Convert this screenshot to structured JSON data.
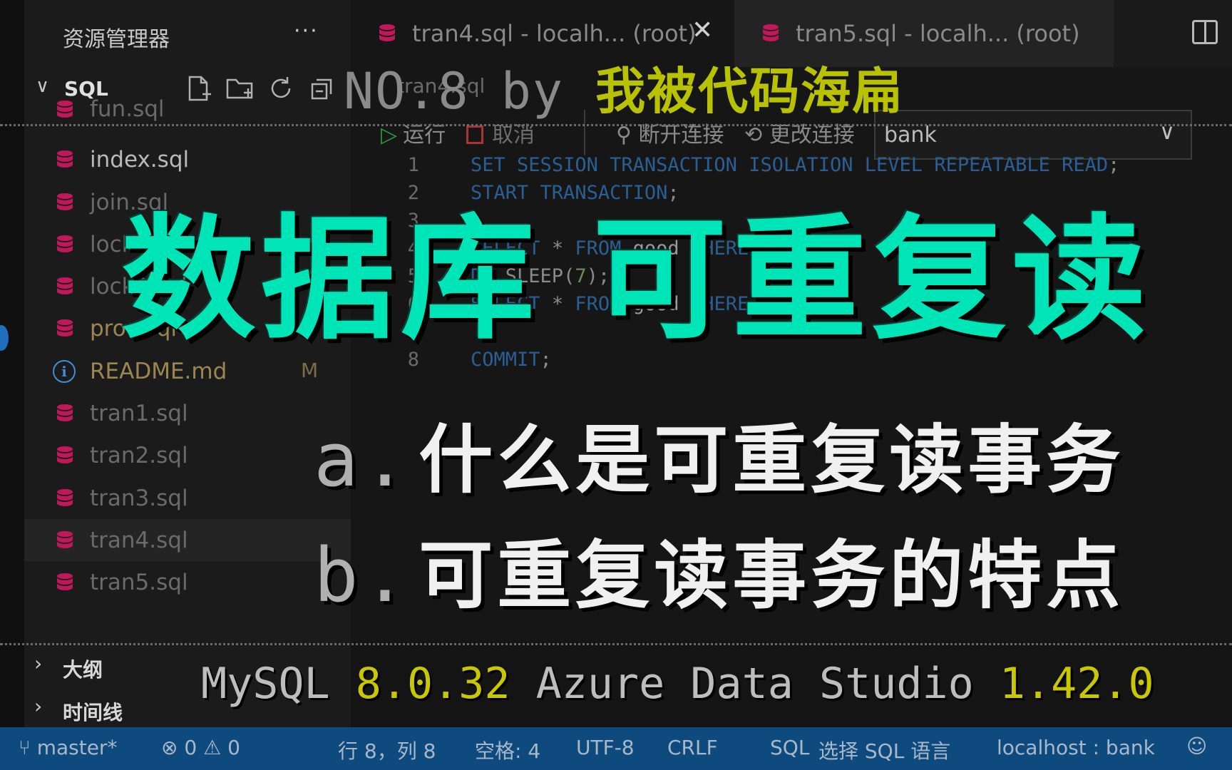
{
  "sidebar": {
    "title": "资源管理器",
    "more": "···",
    "section_title": "SQL",
    "files": [
      {
        "name": "fun.sql",
        "icon": "database-icon",
        "badge": ""
      },
      {
        "name": "index.sql",
        "icon": "database-icon",
        "badge": ""
      },
      {
        "name": "join.sql",
        "icon": "database-icon",
        "badge": ""
      },
      {
        "name": "lock.sql",
        "icon": "database-icon",
        "badge": ""
      },
      {
        "name": "lock2.sql",
        "icon": "database-icon",
        "badge": ""
      },
      {
        "name": "proc.sql",
        "icon": "database-icon",
        "badge": "M"
      },
      {
        "name": "README.md",
        "icon": "info-icon",
        "badge": "M"
      },
      {
        "name": "tran1.sql",
        "icon": "database-icon",
        "badge": ""
      },
      {
        "name": "tran2.sql",
        "icon": "database-icon",
        "badge": ""
      },
      {
        "name": "tran3.sql",
        "icon": "database-icon",
        "badge": ""
      },
      {
        "name": "tran4.sql",
        "icon": "database-icon",
        "badge": "",
        "selected": true
      },
      {
        "name": "tran5.sql",
        "icon": "database-icon",
        "badge": ""
      }
    ],
    "outline_label": "大纲",
    "timeline_label": "时间线"
  },
  "tabs": [
    {
      "label": "tran4.sql - localh... (root)",
      "active": true,
      "close": "✕"
    },
    {
      "label": "tran5.sql - localh... (root)",
      "active": false
    }
  ],
  "editor": {
    "breadcrumb": "tran4.sql",
    "toolbar": {
      "run_label": "运行",
      "cancel_label": "取消",
      "disconnect_label": "断开连接",
      "change_connection_label": "更改连接",
      "database": "bank"
    },
    "code_lines": [
      {
        "n": "1",
        "text": "SET SESSION TRANSACTION ISOLATION LEVEL REPEATABLE READ;"
      },
      {
        "n": "2",
        "text": "START TRANSACTION;"
      },
      {
        "n": "3",
        "text": ""
      },
      {
        "n": "4",
        "text": "SELECT * FROM good WHERE id = 1;"
      },
      {
        "n": "5",
        "text": "DO SLEEP(7);"
      },
      {
        "n": "6",
        "text": "SELECT * FROM good WHERE id = 1;"
      },
      {
        "n": "7",
        "text": ""
      },
      {
        "n": "8",
        "text": "COMMIT;"
      }
    ]
  },
  "status_bar": {
    "branch": "master*",
    "errors": "0",
    "warnings": "0",
    "position": "行 8，列 8",
    "spaces": "空格: 4",
    "encoding": "UTF-8",
    "eol": "CRLF",
    "language": "SQL",
    "select_language": "选择 SQL 语言",
    "connection": "localhost : bank"
  },
  "overlay": {
    "episode": "NO.8 by ",
    "author": "我被代码海扁",
    "title": "数据库 可重复读",
    "item_a_letter": "a.",
    "item_a": "什么是可重复读事务",
    "item_b_letter": "b.",
    "item_b": "可重复读事务的特点",
    "caption_mysql": "MySQL ",
    "caption_mysql_version": "8.0.32",
    "caption_ads": " Azure Data Studio ",
    "caption_ads_version": "1.42.0"
  },
  "colors": {
    "title": "#00e5b8",
    "author": "#b9c200",
    "status_bar": "#0e4a7e",
    "db_icon": "#c2185b",
    "keyword": "#2a5f94"
  }
}
